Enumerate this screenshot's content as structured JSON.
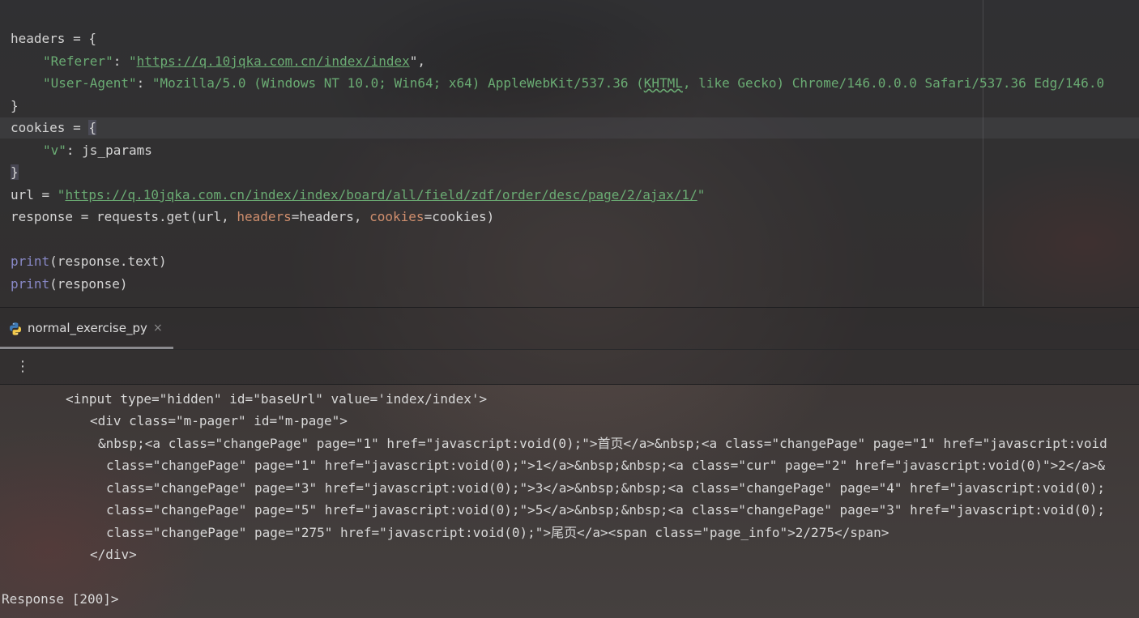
{
  "editor": {
    "lines": {
      "l2": {
        "text": "headers = {"
      },
      "l3": {
        "key": "\"Referer\"",
        "colon": ": ",
        "url": "https://q.10jqka.com.cn/index/index",
        "open_quote": "\"",
        "close": "\","
      },
      "l4": {
        "key": "\"User-Agent\"",
        "colon": ": ",
        "pre": "\"Mozilla/5.0 (Windows NT 10.0; Win64; x64) AppleWebKit/537.36 (",
        "squiggle": "KHTML",
        "post": ", like Gecko) Chrome/146.0.0.0 Safari/537.36 Edg/146.0"
      },
      "l5": {
        "text": "}"
      },
      "l6": {
        "pre": "cookies = ",
        "brace": "{"
      },
      "l7": {
        "key": "\"v\"",
        "rest": ": js_params"
      },
      "l8": {
        "brace": "}"
      },
      "l9": {
        "pre": "url = ",
        "open_quote": "\"",
        "url": "https://q.10jqka.com.cn/index/index/board/all/field/zdf/order/desc/page/2/ajax/1/",
        "close_quote": "\""
      },
      "l10": {
        "pre": "response = requests.get(url, ",
        "p1": "headers",
        "mid": "=headers, ",
        "p2": "cookies",
        "post": "=cookies)"
      },
      "l12": {
        "fn": "print",
        "rest": "(response.text)"
      },
      "l13": {
        "fn": "print",
        "rest": "(response)"
      }
    }
  },
  "run_panel": {
    "tab_label": "normal_exercise_py",
    "close_glyph": "×",
    "more_glyph": "⋮",
    "output": [
      "<input type=\"hidden\" id=\"baseUrl\" value='index/index'>",
      "<div class=\"m-pager\" id=\"m-page\">",
      "&nbsp;<a class=\"changePage\" page=\"1\" href=\"javascript:void(0);\">首页</a>&nbsp;<a class=\"changePage\" page=\"1\" href=\"javascript:void",
      "class=\"changePage\" page=\"1\" href=\"javascript:void(0);\">1</a>&nbsp;&nbsp;<a class=\"cur\" page=\"2\" href=\"javascript:void(0)\">2</a>&",
      "class=\"changePage\" page=\"3\" href=\"javascript:void(0);\">3</a>&nbsp;&nbsp;<a class=\"changePage\" page=\"4\" href=\"javascript:void(0);",
      "class=\"changePage\" page=\"5\" href=\"javascript:void(0);\">5</a>&nbsp;&nbsp;<a class=\"changePage\" page=\"3\" href=\"javascript:void(0);",
      "class=\"changePage\" page=\"275\" href=\"javascript:void(0);\">尾页</a><span class=\"page_info\">2/275</span>",
      "</div>",
      "Response [200]>"
    ]
  },
  "colors": {
    "string": "#6aab73",
    "keyword_param": "#cf8e6d",
    "builtin": "#8888c6",
    "text": "#d4d4d4"
  }
}
